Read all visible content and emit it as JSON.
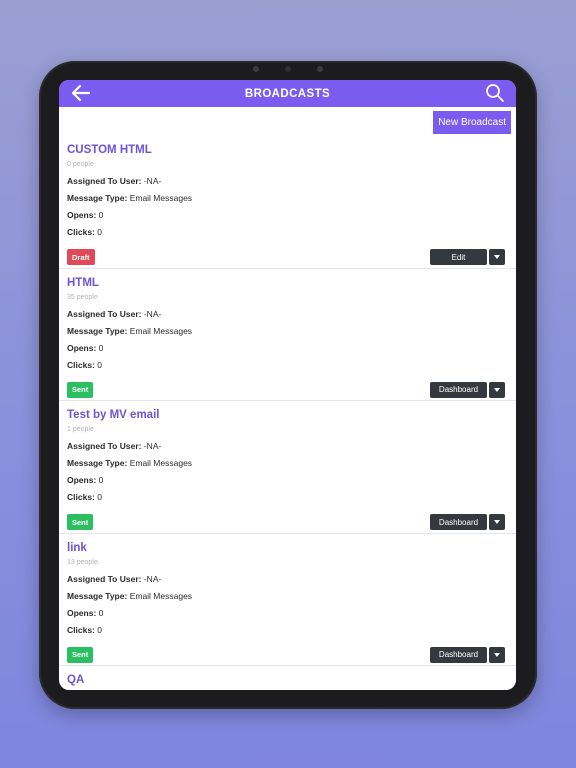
{
  "header": {
    "title": "BROADCASTS"
  },
  "toolbar": {
    "new_broadcast_label": "New Broadcast"
  },
  "labels": {
    "assigned": "Assigned To User:",
    "message_type": "Message Type:",
    "opens": "Opens:",
    "clicks": "Clicks:"
  },
  "broadcasts": [
    {
      "name": "CUSTOM HTML",
      "people": "0 people",
      "assigned": "-NA-",
      "message_type": "Email Messages",
      "opens": "0",
      "clicks": "0",
      "status": "Draft",
      "action": "Edit"
    },
    {
      "name": "HTML",
      "people": "35 people",
      "assigned": "-NA-",
      "message_type": "Email Messages",
      "opens": "0",
      "clicks": "0",
      "status": "Sent",
      "action": "Dashboard"
    },
    {
      "name": "Test by MV email",
      "people": "1 people",
      "assigned": "-NA-",
      "message_type": "Email Messages",
      "opens": "0",
      "clicks": "0",
      "status": "Sent",
      "action": "Dashboard"
    },
    {
      "name": "link",
      "people": "13 people",
      "assigned": "-NA-",
      "message_type": "Email Messages",
      "opens": "0",
      "clicks": "0",
      "status": "Sent",
      "action": "Dashboard"
    },
    {
      "name": "QA"
    }
  ],
  "colors": {
    "accent": "#7b5cf0",
    "draft": "#e0495a",
    "sent": "#2bbf62",
    "action_button": "#34393f"
  },
  "icons": {
    "back": "arrow-left-icon",
    "search": "search-icon",
    "dropdown": "chevron-down-icon"
  }
}
